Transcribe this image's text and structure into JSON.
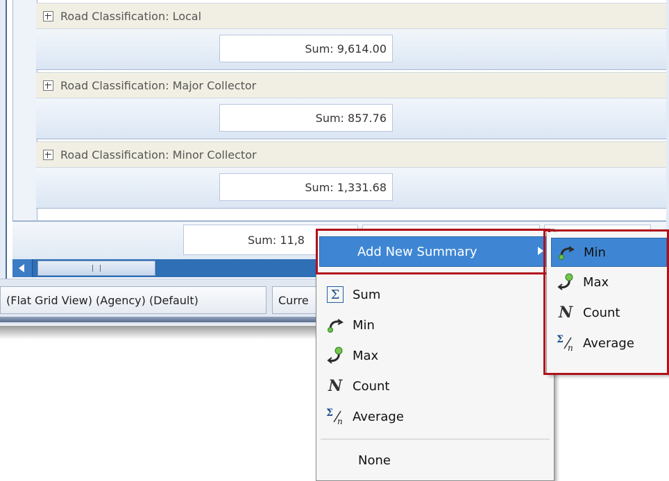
{
  "grid": {
    "groups": [
      {
        "label": "Road Classification: Local",
        "sum": "Sum: 9,614.00"
      },
      {
        "label": "Road Classification: Major Collector",
        "sum": "Sum: 857.76"
      },
      {
        "label": "Road Classification: Minor Collector",
        "sum": "Sum: 1,331.68"
      }
    ],
    "total_sum": "Sum: 11,8"
  },
  "statusbar": {
    "view_label": "(Flat Grid View) (Agency) (Default)",
    "current_label": "Curre"
  },
  "context_menu": {
    "add_new_summary": "Add New Summary",
    "items": [
      {
        "label": "Sum",
        "icon": "sigma-icon"
      },
      {
        "label": "Min",
        "icon": "min-icon"
      },
      {
        "label": "Max",
        "icon": "max-icon"
      },
      {
        "label": "Count",
        "icon": "count-icon"
      },
      {
        "label": "Average",
        "icon": "average-icon"
      }
    ],
    "none_label": "None"
  },
  "submenu": {
    "items": [
      {
        "label": "Min",
        "icon": "min-icon"
      },
      {
        "label": "Max",
        "icon": "max-icon"
      },
      {
        "label": "Count",
        "icon": "count-icon"
      },
      {
        "label": "Average",
        "icon": "average-icon"
      }
    ]
  },
  "colors": {
    "highlight": "#3e86d4",
    "annotation_red": "#b0101c",
    "group_row_bg": "#f1efe3"
  }
}
